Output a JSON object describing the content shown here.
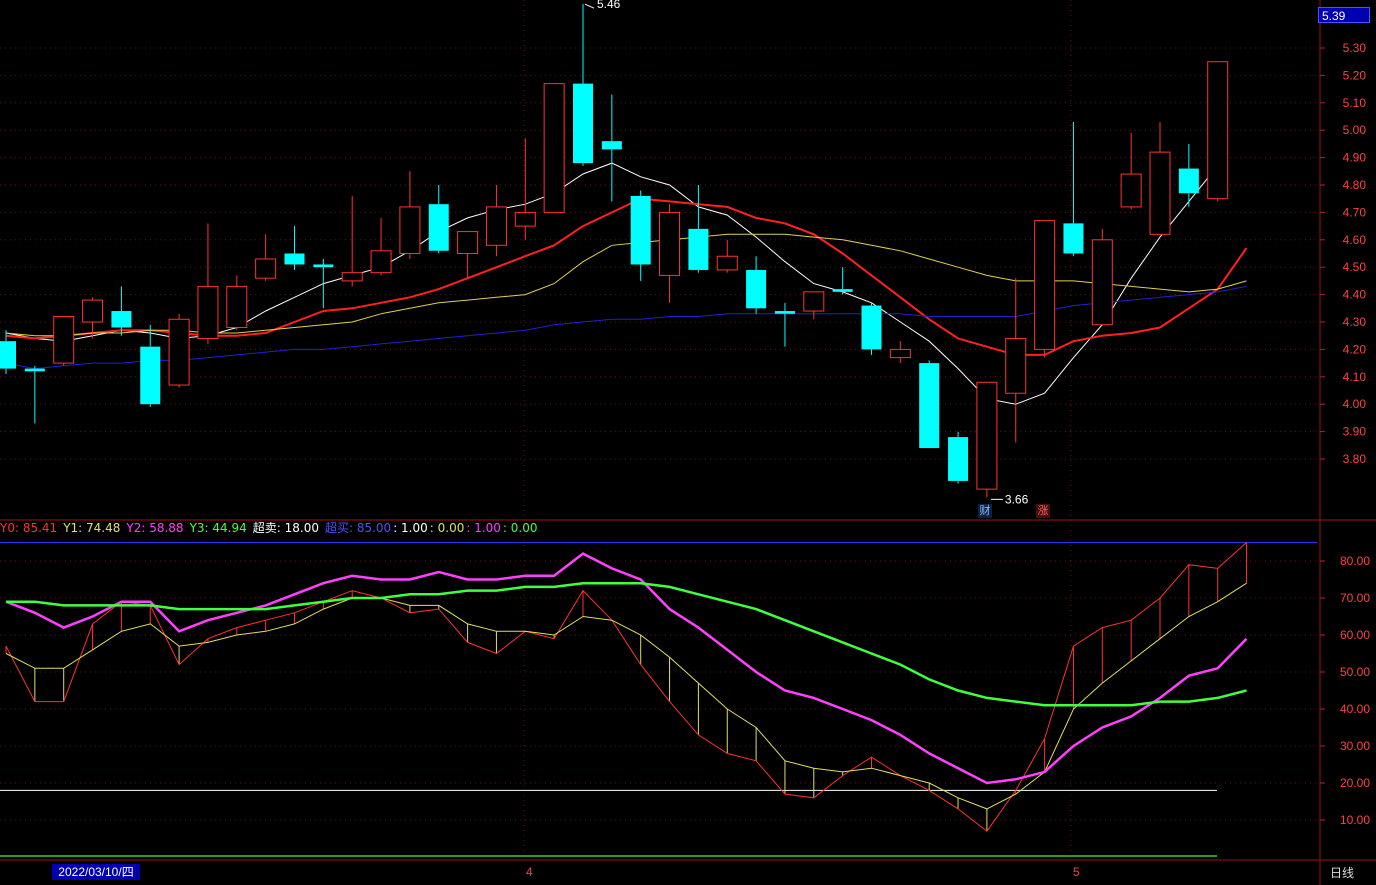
{
  "chart_data": [
    {
      "type": "candlestick",
      "price_axis": {
        "ylim": [
          3.66,
          5.39
        ],
        "ticks": [
          "5.30",
          "5.20",
          "5.10",
          "5.00",
          "4.90",
          "4.80",
          "4.70",
          "4.60",
          "4.50",
          "4.40",
          "4.30",
          "4.20",
          "4.10",
          "4.00",
          "3.90",
          "3.80"
        ]
      },
      "last_price": "5.39",
      "annotations": {
        "high": "5.46",
        "low": "3.66"
      },
      "badges": [
        "财",
        "涨"
      ],
      "candles": [
        {
          "o": 4.23,
          "h": 4.27,
          "l": 4.11,
          "c": 4.13,
          "dir": "down"
        },
        {
          "o": 4.13,
          "h": 4.14,
          "l": 3.93,
          "c": 4.12,
          "dir": "down"
        },
        {
          "o": 4.15,
          "h": 4.28,
          "l": 4.14,
          "c": 4.32,
          "dir": "up"
        },
        {
          "o": 4.3,
          "h": 4.39,
          "l": 4.24,
          "c": 4.38,
          "dir": "up"
        },
        {
          "o": 4.34,
          "h": 4.43,
          "l": 4.25,
          "c": 4.28,
          "dir": "down"
        },
        {
          "o": 4.21,
          "h": 4.29,
          "l": 3.99,
          "c": 4.0,
          "dir": "down"
        },
        {
          "o": 4.07,
          "h": 4.33,
          "l": 4.06,
          "c": 4.31,
          "dir": "up"
        },
        {
          "o": 4.24,
          "h": 4.66,
          "l": 4.22,
          "c": 4.43,
          "dir": "up"
        },
        {
          "o": 4.28,
          "h": 4.47,
          "l": 4.27,
          "c": 4.43,
          "dir": "up"
        },
        {
          "o": 4.46,
          "h": 4.62,
          "l": 4.45,
          "c": 4.53,
          "dir": "up"
        },
        {
          "o": 4.55,
          "h": 4.65,
          "l": 4.49,
          "c": 4.51,
          "dir": "down"
        },
        {
          "o": 4.51,
          "h": 4.53,
          "l": 4.35,
          "c": 4.5,
          "dir": "down"
        },
        {
          "o": 4.45,
          "h": 4.76,
          "l": 4.43,
          "c": 4.48,
          "dir": "up"
        },
        {
          "o": 4.48,
          "h": 4.68,
          "l": 4.47,
          "c": 4.56,
          "dir": "up"
        },
        {
          "o": 4.55,
          "h": 4.85,
          "l": 4.53,
          "c": 4.72,
          "dir": "up"
        },
        {
          "o": 4.73,
          "h": 4.8,
          "l": 4.55,
          "c": 4.56,
          "dir": "down"
        },
        {
          "o": 4.55,
          "h": 4.62,
          "l": 4.46,
          "c": 4.63,
          "dir": "up"
        },
        {
          "o": 4.58,
          "h": 4.8,
          "l": 4.54,
          "c": 4.72,
          "dir": "up"
        },
        {
          "o": 4.65,
          "h": 4.97,
          "l": 4.6,
          "c": 4.7,
          "dir": "up"
        },
        {
          "o": 4.7,
          "h": 5.05,
          "l": 4.7,
          "c": 5.17,
          "dir": "up"
        },
        {
          "o": 5.17,
          "h": 5.46,
          "l": 4.87,
          "c": 4.88,
          "dir": "down"
        },
        {
          "o": 4.96,
          "h": 5.13,
          "l": 4.74,
          "c": 4.93,
          "dir": "down"
        },
        {
          "o": 4.76,
          "h": 4.78,
          "l": 4.45,
          "c": 4.51,
          "dir": "down"
        },
        {
          "o": 4.47,
          "h": 4.73,
          "l": 4.37,
          "c": 4.7,
          "dir": "up"
        },
        {
          "o": 4.64,
          "h": 4.8,
          "l": 4.48,
          "c": 4.49,
          "dir": "down"
        },
        {
          "o": 4.49,
          "h": 4.6,
          "l": 4.48,
          "c": 4.54,
          "dir": "up"
        },
        {
          "o": 4.49,
          "h": 4.54,
          "l": 4.33,
          "c": 4.35,
          "dir": "down"
        },
        {
          "o": 4.34,
          "h": 4.37,
          "l": 4.21,
          "c": 4.33,
          "dir": "down"
        },
        {
          "o": 4.34,
          "h": 4.41,
          "l": 4.31,
          "c": 4.41,
          "dir": "up"
        },
        {
          "o": 4.42,
          "h": 4.5,
          "l": 4.4,
          "c": 4.41,
          "dir": "down"
        },
        {
          "o": 4.36,
          "h": 4.37,
          "l": 4.18,
          "c": 4.2,
          "dir": "down"
        },
        {
          "o": 4.17,
          "h": 4.23,
          "l": 4.15,
          "c": 4.2,
          "dir": "up"
        },
        {
          "o": 4.15,
          "h": 4.16,
          "l": 3.84,
          "c": 3.84,
          "dir": "down"
        },
        {
          "o": 3.88,
          "h": 3.9,
          "l": 3.71,
          "c": 3.72,
          "dir": "down"
        },
        {
          "o": 3.69,
          "h": 4.08,
          "l": 3.66,
          "c": 4.08,
          "dir": "up"
        },
        {
          "o": 4.04,
          "h": 4.46,
          "l": 3.86,
          "c": 4.24,
          "dir": "up"
        },
        {
          "o": 4.2,
          "h": 4.67,
          "l": 4.17,
          "c": 4.67,
          "dir": "up"
        },
        {
          "o": 4.66,
          "h": 5.03,
          "l": 4.54,
          "c": 4.55,
          "dir": "down"
        },
        {
          "o": 4.29,
          "h": 4.64,
          "l": 4.29,
          "c": 4.6,
          "dir": "up"
        },
        {
          "o": 4.72,
          "h": 4.99,
          "l": 4.71,
          "c": 4.84,
          "dir": "up"
        },
        {
          "o": 4.62,
          "h": 5.03,
          "l": 4.62,
          "c": 4.92,
          "dir": "up"
        },
        {
          "o": 4.77,
          "h": 4.95,
          "l": 4.72,
          "c": 4.86,
          "dir": "down"
        },
        {
          "o": 4.75,
          "h": 5.25,
          "l": 4.74,
          "c": 5.25,
          "dir": "up"
        }
      ],
      "ma_lines": [
        {
          "color": "#ffffff",
          "values": [
            4.26,
            4.24,
            4.23,
            4.25,
            4.27,
            4.26,
            4.24,
            4.25,
            4.28,
            4.34,
            4.39,
            4.44,
            4.47,
            4.5,
            4.56,
            4.63,
            4.68,
            4.71,
            4.73,
            4.77,
            4.84,
            4.88,
            4.83,
            4.8,
            4.72,
            4.69,
            4.61,
            4.52,
            4.44,
            4.41,
            4.37,
            4.3,
            4.23,
            4.13,
            4.02,
            4.0,
            4.04,
            4.17,
            4.29,
            4.46,
            4.61,
            4.74,
            4.87
          ]
        },
        {
          "color": "#ff2020",
          "values": [
            4.25,
            4.24,
            4.25,
            4.26,
            4.27,
            4.27,
            4.26,
            4.25,
            4.25,
            4.26,
            4.3,
            4.34,
            4.35,
            4.37,
            4.39,
            4.42,
            4.46,
            4.5,
            4.54,
            4.58,
            4.65,
            4.7,
            4.75,
            4.74,
            4.73,
            4.72,
            4.68,
            4.66,
            4.62,
            4.55,
            4.47,
            4.39,
            4.31,
            4.24,
            4.21,
            4.18,
            4.18,
            4.23,
            4.25,
            4.26,
            4.28,
            4.35,
            4.42,
            4.57
          ]
        },
        {
          "color": "#e0d050",
          "values": [
            4.26,
            4.25,
            4.25,
            4.26,
            4.26,
            4.27,
            4.27,
            4.26,
            4.26,
            4.27,
            4.28,
            4.29,
            4.3,
            4.33,
            4.35,
            4.37,
            4.38,
            4.39,
            4.4,
            4.44,
            4.52,
            4.58,
            4.59,
            4.6,
            4.61,
            4.62,
            4.62,
            4.62,
            4.61,
            4.6,
            4.58,
            4.56,
            4.53,
            4.5,
            4.47,
            4.45,
            4.45,
            4.45,
            4.44,
            4.43,
            4.42,
            4.41,
            4.42,
            4.45
          ]
        },
        {
          "color": "#2020d0",
          "values": [
            4.15,
            4.13,
            4.14,
            4.15,
            4.15,
            4.16,
            4.16,
            4.17,
            4.18,
            4.19,
            4.2,
            4.2,
            4.21,
            4.22,
            4.23,
            4.24,
            4.25,
            4.26,
            4.27,
            4.29,
            4.3,
            4.31,
            4.31,
            4.32,
            4.32,
            4.33,
            4.33,
            4.33,
            4.33,
            4.33,
            4.33,
            4.33,
            4.32,
            4.32,
            4.32,
            4.32,
            4.34,
            4.36,
            4.37,
            4.38,
            4.39,
            4.4,
            4.41,
            4.43
          ]
        }
      ]
    },
    {
      "type": "line",
      "ylim": [
        0,
        87
      ],
      "ticks": [
        "80.00",
        "70.00",
        "60.00",
        "50.00",
        "40.00",
        "30.00",
        "20.00",
        "10.00"
      ],
      "legend": [
        {
          "text": "Y0: 85.41",
          "color": "#ff3030"
        },
        {
          "text": "Y1: 74.48",
          "color": "#e0e060"
        },
        {
          "text": "Y2: 58.88",
          "color": "#ff40ff"
        },
        {
          "text": "Y3: 44.94",
          "color": "#40ff40"
        },
        {
          "text": "超卖: 18.00",
          "color": "#ffffff"
        },
        {
          "text": "超买: 85.00",
          "color": "#5050ff"
        },
        {
          "text": ": 1.00",
          "color": "#ffffff"
        },
        {
          "text": ": 0.00",
          "color": "#e0e060"
        },
        {
          "text": ": 1.00",
          "color": "#ff40ff"
        },
        {
          "text": ": 0.00",
          "color": "#40ff40"
        }
      ],
      "levels": {
        "oversold": 18,
        "overbought": 85
      },
      "series": [
        {
          "color": "#ff3030",
          "values": [
            57,
            42,
            42,
            63,
            69,
            68,
            52,
            59,
            62,
            64,
            66,
            69,
            72,
            70,
            66,
            67,
            58,
            55,
            61,
            59,
            72,
            64,
            52,
            42,
            33,
            28,
            26,
            17,
            16,
            22,
            27,
            22,
            18,
            13,
            7,
            18,
            32,
            57,
            62,
            64,
            70,
            79,
            78,
            85
          ]
        },
        {
          "color": "#e0e060",
          "values": [
            55,
            51,
            51,
            56,
            61,
            63,
            57,
            58,
            60,
            61,
            63,
            67,
            70,
            70,
            68,
            68,
            63,
            61,
            61,
            60,
            65,
            64,
            60,
            54,
            47,
            40,
            35,
            26,
            24,
            23,
            24,
            22,
            20,
            16,
            13,
            17,
            23,
            40,
            47,
            53,
            59,
            65,
            69,
            74
          ]
        },
        {
          "color": "#ff40ff",
          "values": [
            69,
            66,
            62,
            65,
            69,
            69,
            61,
            64,
            66,
            68,
            71,
            74,
            76,
            75,
            75,
            77,
            75,
            75,
            76,
            76,
            82,
            78,
            75,
            67,
            62,
            56,
            50,
            45,
            43,
            40,
            37,
            33,
            28,
            24,
            20,
            21,
            23,
            30,
            35,
            38,
            43,
            49,
            51,
            59
          ]
        },
        {
          "color": "#40ff40",
          "values": [
            69,
            69,
            68,
            68,
            68,
            68,
            67,
            67,
            67,
            67,
            68,
            69,
            70,
            70,
            71,
            71,
            72,
            72,
            73,
            73,
            74,
            74,
            74,
            73,
            71,
            69,
            67,
            64,
            61,
            58,
            55,
            52,
            48,
            45,
            43,
            42,
            41,
            41,
            41,
            41,
            42,
            42,
            43,
            45
          ]
        }
      ]
    }
  ],
  "axis": {
    "date_label": "2022/03/10/四",
    "month_labels": [
      "4",
      "5"
    ],
    "period_label": "日线"
  }
}
